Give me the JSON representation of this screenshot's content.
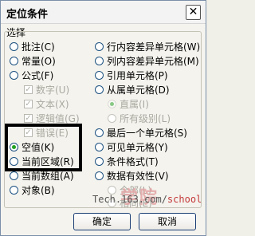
{
  "dialog": {
    "title": "定位条件",
    "close_glyph": "✕",
    "group_label": "选择"
  },
  "left_options": [
    {
      "label": "批注(C)",
      "selected": false
    },
    {
      "label": "常量(O)",
      "selected": false
    },
    {
      "label": "公式(F)",
      "selected": false
    },
    {
      "label": "数字(U)",
      "type": "check",
      "enabled": false
    },
    {
      "label": "文本(X)",
      "type": "check",
      "enabled": false
    },
    {
      "label": "逻辑值(G)",
      "type": "check",
      "enabled": false
    },
    {
      "label": "错误(E)",
      "type": "check",
      "enabled": false
    },
    {
      "label": "空值(K)",
      "selected": true
    },
    {
      "label": "当前区域(R)",
      "selected": false
    },
    {
      "label": "当前数组(A)",
      "selected": false
    },
    {
      "label": "对象(B)",
      "selected": false
    }
  ],
  "right_options": [
    {
      "label": "行内容差异单元格(W)",
      "selected": false
    },
    {
      "label": "列内容差异单元格(M)",
      "selected": false
    },
    {
      "label": "引用单元格(P)",
      "selected": false
    },
    {
      "label": "从属单元格(D)",
      "selected": false
    },
    {
      "label": "直属(I)",
      "selected": true,
      "enabled": false
    },
    {
      "label": "所有级别(L)",
      "selected": false,
      "enabled": false
    },
    {
      "label": "最后一个单元格(S)",
      "selected": false
    },
    {
      "label": "可见单元格(Y)",
      "selected": false
    },
    {
      "label": "条件格式(T)",
      "selected": false
    },
    {
      "label": "数据有效性(V)",
      "selected": false
    },
    {
      "label": "全部(L)",
      "selected": false,
      "enabled": false
    },
    {
      "label": "相同(E)",
      "selected": false,
      "enabled": false
    }
  ],
  "buttons": {
    "ok": "确定",
    "cancel": "取消"
  },
  "watermark": {
    "brand": "学院",
    "site_prefix": "Tech.163.com/",
    "site_suffix": "school"
  },
  "colors": {
    "radio_dot": "#21a121",
    "highlight_box": "#000000",
    "watermark": "#e3a5a5"
  }
}
